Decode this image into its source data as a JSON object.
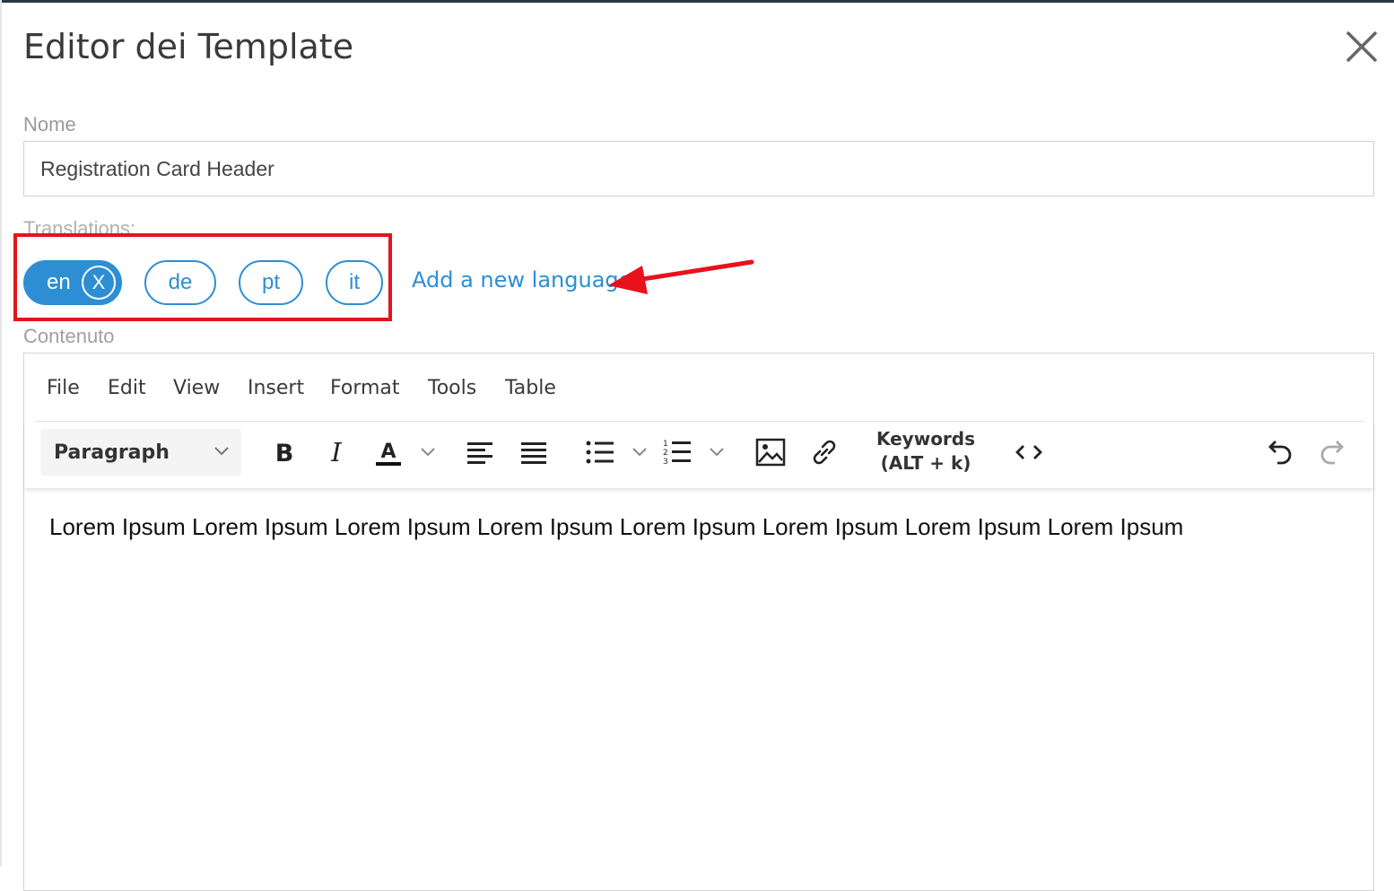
{
  "modal": {
    "title": "Editor dei Template"
  },
  "name_field": {
    "label": "Nome",
    "value": "Registration Card Header"
  },
  "translations": {
    "label": "Translations:",
    "languages": [
      {
        "code": "en",
        "active": true,
        "remove_glyph": "X"
      },
      {
        "code": "de",
        "active": false
      },
      {
        "code": "pt",
        "active": false
      },
      {
        "code": "it",
        "active": false
      }
    ],
    "add_label": "Add a new language"
  },
  "content": {
    "label": "Contenuto",
    "menu": [
      "File",
      "Edit",
      "View",
      "Insert",
      "Format",
      "Tools",
      "Table"
    ],
    "toolbar": {
      "block_format": "Paragraph",
      "keywords_line1": "Keywords",
      "keywords_line2": "(ALT + k)"
    },
    "body_text": "Lorem Ipsum Lorem Ipsum Lorem Ipsum Lorem Ipsum Lorem Ipsum Lorem Ipsum Lorem Ipsum Lorem Ipsum"
  },
  "colors": {
    "accent": "#2d8ed4",
    "annotation_red": "#e8121d",
    "topbar": "#2b3a44"
  },
  "icons": [
    "close-icon",
    "chevron-down-icon",
    "bold-icon",
    "italic-icon",
    "text-color-icon",
    "align-left-icon",
    "align-justify-icon",
    "bullet-list-icon",
    "numbered-list-icon",
    "image-icon",
    "link-icon",
    "code-icon",
    "undo-icon",
    "redo-icon",
    "arrow-annotation"
  ]
}
